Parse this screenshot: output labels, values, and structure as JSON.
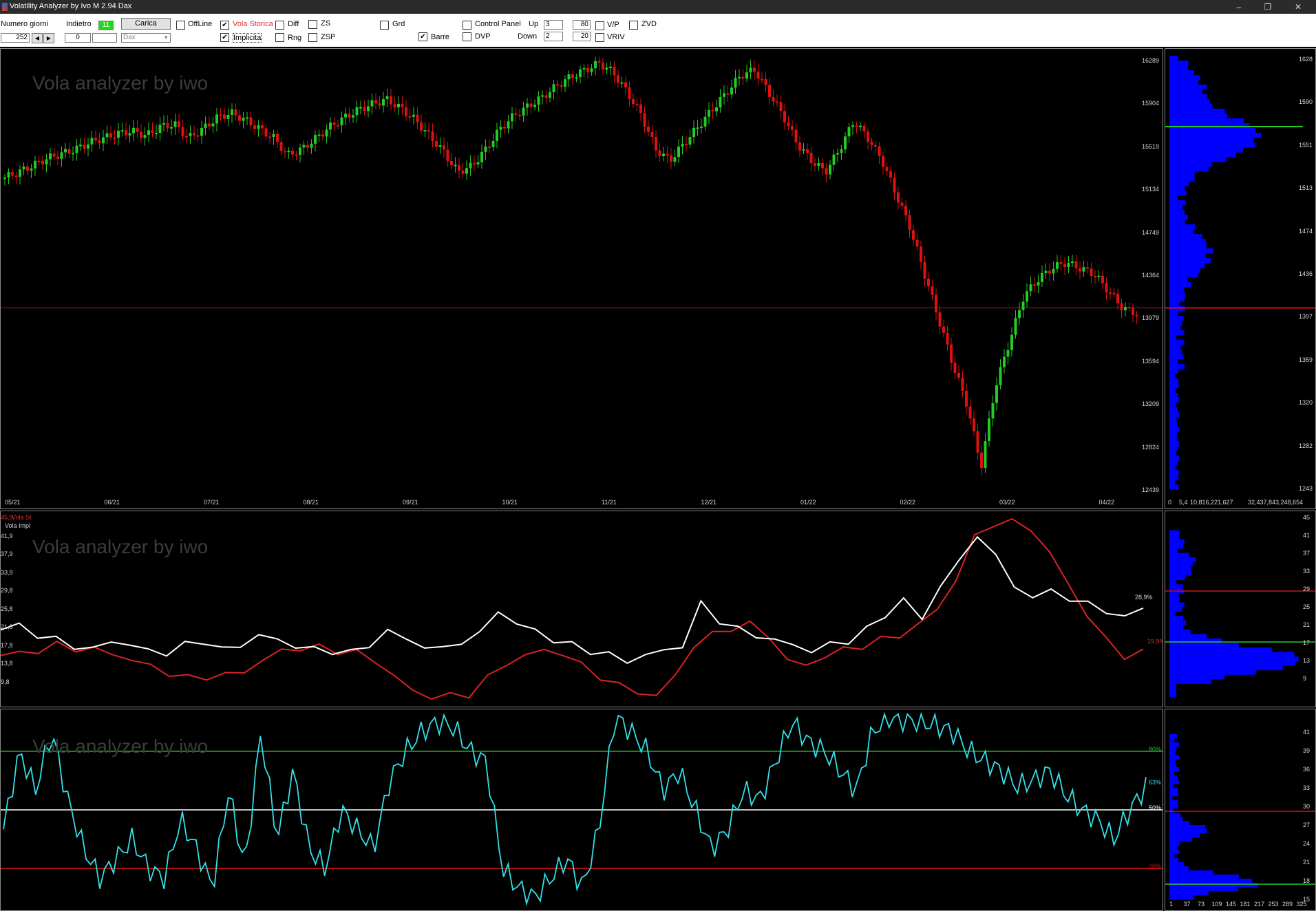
{
  "window": {
    "title": "Volatility Analyzer by Ivo M 2.94  Dax",
    "minimize": "–",
    "restore": "❐",
    "close": "✕"
  },
  "toolbar": {
    "numero_giorni_label": "Numero giorni",
    "numero_giorni_value": "252",
    "indietro_label": "Indietro",
    "indietro_value": "0",
    "green_indicator": "11",
    "carica_label": "Carica",
    "ticker_value": "Dax",
    "offline_label": "OffLine",
    "vola_storica_label": "Vola Storica",
    "implicita_label": "Implicita",
    "diff_label": "Diff",
    "rng_label": "Rng",
    "zs_label": "ZS",
    "zsp_label": "ZSP",
    "grd_label": "Grd",
    "barre_label": "Barre",
    "control_panel_label": "Control Panel",
    "dvp_label": "DVP",
    "up_label": "Up",
    "down_label": "Down",
    "up_value": "3",
    "down_value": "2",
    "up_pct": "80",
    "down_pct": "20",
    "vp_label": "V/P",
    "vriv_label": "VRIV",
    "zvd_label": "ZVD"
  },
  "watermark": "Vola analyzer by iwo",
  "colors": {
    "bull": "#22cc22",
    "bear": "#dd1111",
    "vol_hist": "#ffffff",
    "vol_impl": "#dd2222",
    "osc": "#33e0e8",
    "profile": "#0000ff",
    "line_green": "#22cc22",
    "line_red": "#cc1111",
    "line_white": "#ffffff"
  },
  "price_chart": {
    "y_ticks": [
      "16289",
      "15904",
      "15519",
      "15134",
      "14749",
      "14364",
      "13979",
      "13594",
      "13209",
      "12824",
      "12439"
    ],
    "x_ticks": [
      "05/21",
      "06/21",
      "07/21",
      "08/21",
      "09/21",
      "10/21",
      "11/21",
      "12/21",
      "01/22",
      "02/22",
      "03/22",
      "04/22"
    ],
    "volume_profile_x_ticks": [
      "0",
      "5,4",
      "10,816,221,627",
      "32,437,843,248,654"
    ],
    "profile_y_ticks": [
      "1628",
      "1590",
      "1551",
      "1513",
      "1474",
      "1436",
      "1397",
      "1359",
      "1320",
      "1282",
      "1243"
    ],
    "current_price_level": 14100,
    "profile_peak_level": 15700,
    "series": [
      15250,
      15300,
      15360,
      15420,
      15460,
      15500,
      15560,
      15600,
      15640,
      15660,
      15620,
      15700,
      15720,
      15600,
      15680,
      15780,
      15820,
      15760,
      15680,
      15600,
      15450,
      15500,
      15600,
      15700,
      15780,
      15850,
      15900,
      15940,
      15860,
      15760,
      15620,
      15480,
      15300,
      15350,
      15500,
      15680,
      15800,
      15880,
      15960,
      16060,
      16140,
      16200,
      16260,
      16180,
      16000,
      15800,
      15500,
      15400,
      15550,
      15700,
      15850,
      16000,
      16150,
      16200,
      16000,
      15800,
      15550,
      15400,
      15300,
      15500,
      15750,
      15600,
      15400,
      15100,
      14800,
      14400,
      14000,
      13600,
      13250,
      12700,
      13400,
      13800,
      14200,
      14350,
      14450,
      14500,
      14450,
      14400,
      14250,
      14100,
      14050
    ]
  },
  "vol_chart": {
    "y_ticks": [
      "45,9",
      "41,9",
      "37,9",
      "33,9",
      "29,8",
      "25,8",
      "21,8",
      "17,8",
      "13,8",
      "9,8"
    ],
    "legend_hist": "Vola St",
    "legend_impl": "Vola Impl",
    "hist_last": "28,9%",
    "impl_last": "19,9%",
    "profile_y_ticks": [
      "45",
      "41",
      "37",
      "33",
      "29",
      "25",
      "21",
      "17",
      "13",
      "9"
    ],
    "ylim": [
      9.8,
      45.9
    ],
    "vola_impl": [
      19,
      19.5,
      20,
      21,
      20.5,
      20,
      19.5,
      18,
      17,
      15.5,
      14.5,
      15,
      15,
      16,
      18,
      20,
      20.5,
      20.5,
      20,
      19.5,
      18,
      15,
      12,
      11,
      11,
      11.5,
      14.5,
      17.5,
      19,
      20,
      19.5,
      17,
      15,
      13,
      12,
      11,
      15,
      21,
      23,
      24.5,
      25,
      23,
      18,
      17,
      19,
      20,
      21,
      22,
      23,
      25,
      28,
      34,
      42,
      45,
      45,
      44,
      39,
      33,
      27,
      22,
      19,
      19.5
    ],
    "vola_hist": [
      24,
      25,
      23,
      22,
      21,
      20,
      22,
      21,
      20,
      19.5,
      21,
      22,
      20,
      21,
      23,
      22,
      21,
      20,
      20,
      19.5,
      21,
      24,
      22,
      21,
      20,
      22,
      23,
      28,
      25,
      24,
      22,
      21,
      20,
      19,
      18,
      19,
      20,
      21,
      29,
      26,
      24,
      23,
      22,
      21,
      20,
      21,
      22,
      24,
      27,
      30,
      26,
      33,
      37,
      43,
      38,
      33,
      30,
      32,
      30,
      29,
      28,
      26,
      28.9
    ]
  },
  "osc_chart": {
    "y_ticks_right": [
      "80%",
      "63%",
      "50%",
      "20%"
    ],
    "levels": {
      "upper": 80,
      "mid": 50,
      "lower": 20
    },
    "profile_y_ticks": [
      "41",
      "39",
      "36",
      "33",
      "30",
      "27",
      "24",
      "21",
      "18",
      "15"
    ],
    "profile_x_ticks": [
      "1",
      "37",
      "73",
      "109",
      "145",
      "181",
      "217",
      "253",
      "289",
      "325"
    ],
    "series": [
      40,
      80,
      60,
      90,
      55,
      30,
      15,
      25,
      35,
      20,
      15,
      45,
      30,
      10,
      60,
      20,
      90,
      35,
      70,
      30,
      20,
      50,
      40,
      30,
      65,
      80,
      90,
      95,
      92,
      80,
      75,
      20,
      10,
      5,
      15,
      25,
      10,
      40,
      98,
      90,
      80,
      60,
      70,
      50,
      30,
      40,
      60,
      55,
      75,
      95,
      85,
      80,
      70,
      60,
      90,
      97,
      96,
      95,
      93,
      90,
      80,
      75,
      70,
      62,
      65,
      70,
      58,
      50,
      45,
      35,
      50,
      62
    ]
  }
}
